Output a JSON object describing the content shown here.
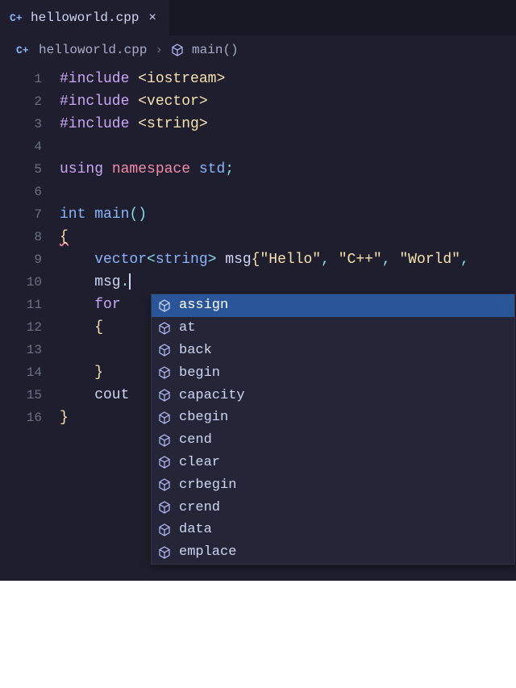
{
  "tab": {
    "filename": "helloworld.cpp",
    "close_glyph": "×"
  },
  "breadcrumb": {
    "file": "helloworld.cpp",
    "symbol": "main()",
    "separator": "›"
  },
  "gutter": {
    "lines": [
      "1",
      "2",
      "3",
      "4",
      "5",
      "6",
      "7",
      "8",
      "9",
      "10",
      "11",
      "12",
      "13",
      "14",
      "15",
      "16"
    ]
  },
  "code": {
    "l1_a": "#include",
    "l1_b": " <iostream>",
    "l2_a": "#include",
    "l2_b": " <vector>",
    "l3_a": "#include",
    "l3_b": " <string>",
    "l5_a": "using",
    "l5_b": " namespace ",
    "l5_c": "std",
    "l5_d": ";",
    "l7_a": "int",
    "l7_b": " ",
    "l7_c": "main",
    "l7_d": "()",
    "l8": "{",
    "l9_a": "    vector",
    "l9_b": "<",
    "l9_c": "string",
    "l9_d": "> ",
    "l9_e": "msg",
    "l9_f": "{",
    "l9_g": "\"Hello\"",
    "l9_h": ", ",
    "l9_i": "\"C++\"",
    "l9_j": ", ",
    "l9_k": "\"World\"",
    "l9_l": ",",
    "l10_a": "    msg",
    "l10_b": ".",
    "l11_a": "    ",
    "l11_b": "for",
    "l12": "    {",
    "l13": "    ",
    "l14": "    }",
    "l15_a": "    cout",
    "l16": "}"
  },
  "autocomplete": {
    "items": [
      {
        "label": "assign",
        "selected": true
      },
      {
        "label": "at",
        "selected": false
      },
      {
        "label": "back",
        "selected": false
      },
      {
        "label": "begin",
        "selected": false
      },
      {
        "label": "capacity",
        "selected": false
      },
      {
        "label": "cbegin",
        "selected": false
      },
      {
        "label": "cend",
        "selected": false
      },
      {
        "label": "clear",
        "selected": false
      },
      {
        "label": "crbegin",
        "selected": false
      },
      {
        "label": "crend",
        "selected": false
      },
      {
        "label": "data",
        "selected": false
      },
      {
        "label": "emplace",
        "selected": false
      }
    ]
  },
  "icons": {
    "cpp_badge": "C+"
  }
}
